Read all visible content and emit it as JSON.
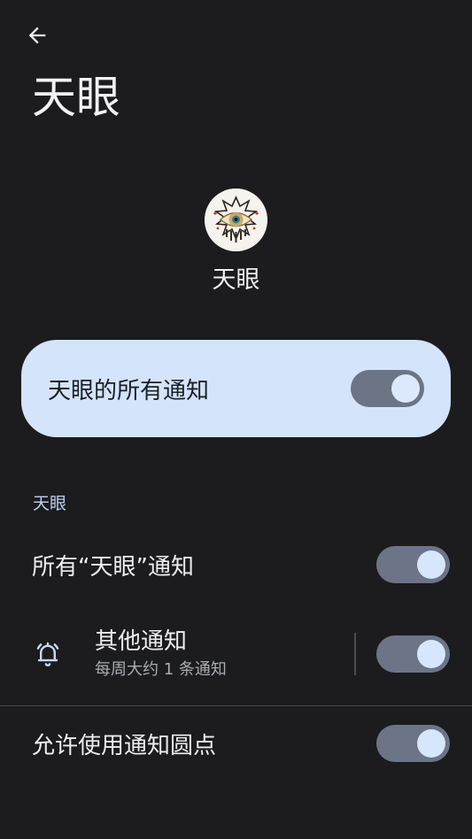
{
  "header": {
    "back_icon": "arrow-left-icon",
    "title": "天眼"
  },
  "app": {
    "icon": "eye-emblem-icon",
    "name": "天眼"
  },
  "master_toggle": {
    "label": "天眼的所有通知",
    "on": true
  },
  "section": {
    "header": "天眼"
  },
  "settings": {
    "all_channel": {
      "label": "所有“天眼”通知",
      "on": true
    },
    "other": {
      "icon": "bell-alert-icon",
      "title": "其他通知",
      "subtitle": "每周大约 1 条通知",
      "on": true
    },
    "dot": {
      "label": "允许使用通知圆点",
      "on": true
    }
  },
  "colors": {
    "background": "#1c1c1e",
    "card": "#d3e4fb",
    "accent": "#b9d1f2",
    "switch_track": "#6b7587",
    "switch_thumb": "#d6e6fc"
  }
}
